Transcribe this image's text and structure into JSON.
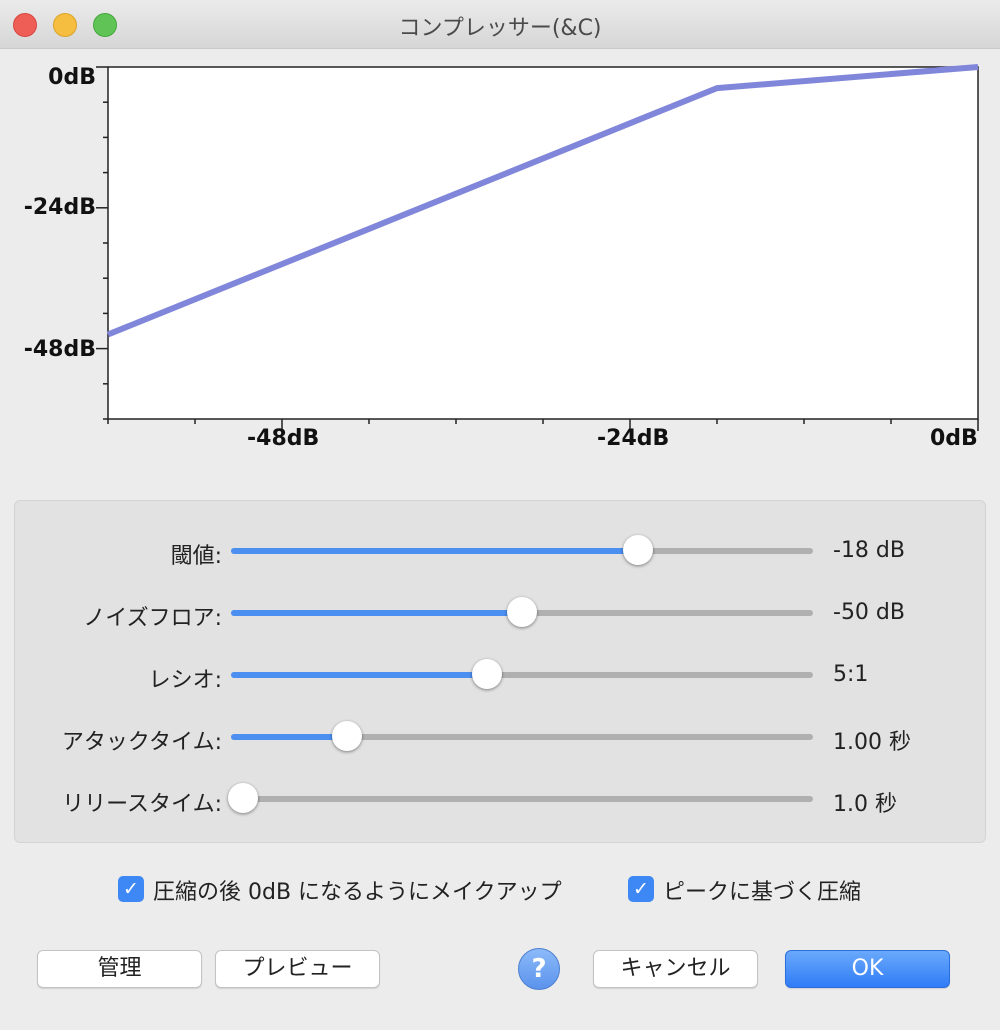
{
  "window": {
    "title": "コンプレッサー(&C)"
  },
  "graph": {
    "y_labels": [
      "0dB",
      "-24dB",
      "-48dB"
    ],
    "x_labels": [
      "-48dB",
      "-24dB",
      "0dB"
    ],
    "curve_color": "#8086d9",
    "threshold_db": -18,
    "ratio": 5,
    "input_range_db": [
      -60,
      0
    ],
    "output_range_db": [
      -60,
      0
    ]
  },
  "controls": [
    {
      "label": "閾値:",
      "value": "-18 dB",
      "level": 0.7
    },
    {
      "label": "ノイズフロア:",
      "value": "-50 dB",
      "level": 0.5
    },
    {
      "label": "レシオ:",
      "value": "5:1",
      "level": 0.44
    },
    {
      "label": "アタックタイム:",
      "value": "1.00 秒",
      "level": 0.2
    },
    {
      "label": "リリースタイム:",
      "value": "1.0 秒",
      "level": 0.02
    }
  ],
  "checkboxes": [
    {
      "label": "圧縮の後 0dB になるようにメイクアップ",
      "checked": true
    },
    {
      "label": "ピークに基づく圧縮",
      "checked": true
    }
  ],
  "buttons": {
    "manage": "管理",
    "preview": "プレビュー",
    "help": "?",
    "cancel": "キャンセル",
    "ok": "OK"
  },
  "colors": {
    "slider_fill": "#4b8ff1",
    "accent": "#2f7cf6"
  }
}
